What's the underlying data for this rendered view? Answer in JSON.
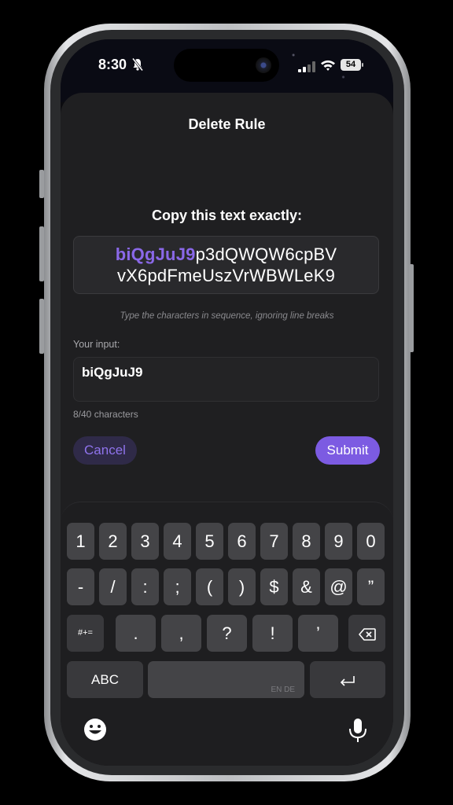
{
  "status_bar": {
    "time": "8:30",
    "battery": "54"
  },
  "dialog": {
    "title": "Delete Rule",
    "copy_label": "Copy this text exactly:",
    "code_typed": "biQgJuJ9",
    "code_rest_line1": "p3dQWQW6cpBV",
    "code_line2": "vX6pdFmeUszVrWBWLeK9",
    "hint": "Type the characters in sequence, ignoring line breaks",
    "input_label": "Your input:",
    "input_value": "biQgJuJ9",
    "char_count": "8/40 characters",
    "cancel_label": "Cancel",
    "submit_label": "Submit",
    "accent_color": "#7c5be2"
  },
  "keyboard": {
    "row1": [
      "1",
      "2",
      "3",
      "4",
      "5",
      "6",
      "7",
      "8",
      "9",
      "0"
    ],
    "row2": [
      "-",
      "/",
      ":",
      ";",
      "(",
      ")",
      "$",
      "&",
      "@",
      "”"
    ],
    "row3": [
      ".",
      ",",
      "?",
      "!",
      "’"
    ],
    "symbols_key": "#+=",
    "abc_key": "ABC",
    "space_languages": "EN DE",
    "icons": [
      "backspace-icon",
      "return-icon",
      "emoji-icon",
      "microphone-icon"
    ]
  }
}
